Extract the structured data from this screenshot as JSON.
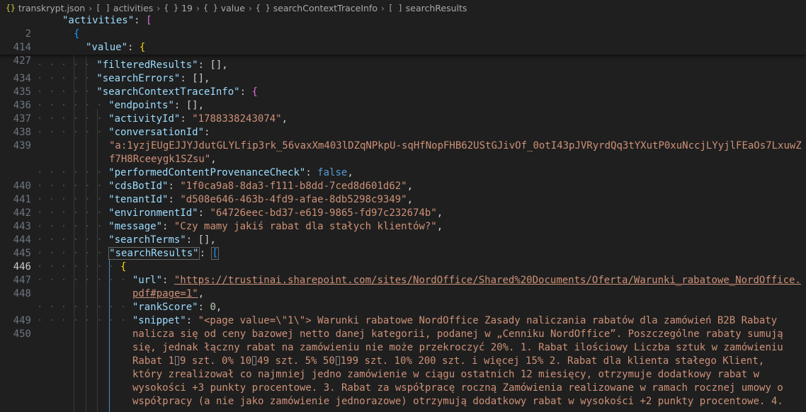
{
  "breadcrumb": {
    "file": "transkrypt.json",
    "segments": [
      "activities",
      "19",
      "value",
      "searchContextTraceInfo",
      "searchResults"
    ],
    "segment_icons": [
      "[ ]",
      "{ }",
      "{ }",
      "{ }",
      "[ ]"
    ]
  },
  "sticky": [
    {
      "ln": "2",
      "key": "\"activities\"",
      "punct": ": ",
      "open": "["
    },
    {
      "ln": "414",
      "open": "{"
    },
    {
      "ln": "427",
      "key": "\"value\"",
      "punct": ": ",
      "open": "{"
    }
  ],
  "lines": {
    "l434": {
      "ln": "434",
      "key": "\"filteredResults\"",
      "rest": ": [],"
    },
    "l435": {
      "ln": "435",
      "key": "\"searchErrors\"",
      "rest": ": [],"
    },
    "l436": {
      "ln": "436",
      "key": "\"searchContextTraceInfo\"",
      "rest": ": ",
      "open": "{"
    },
    "l437": {
      "ln": "437",
      "key": "\"endpoints\"",
      "rest": ": [],"
    },
    "l438": {
      "ln": "438",
      "key": "\"activityId\"",
      "rest": ": ",
      "val": "\"1788338243074\"",
      "end": ","
    },
    "l439": {
      "ln": "439",
      "key": "\"conversationId\"",
      "rest": ":",
      "val1": "\"a:1yzjEUgEJJYJdutGLYLfip3rk_56vaxXm403lDZqNPkpU-sqHfNopFHB62UStGJivOf_0otI43pJVRyrdQq3tYXutP0xuNccjLYyjlFEaOs7LxuwZ",
      "val2": "f7H8Rceeygk1SZsu\"",
      "end": ","
    },
    "l440": {
      "ln": "440",
      "key": "\"performedContentProvenanceCheck\"",
      "rest": ": ",
      "val": "false",
      "end": ","
    },
    "l441": {
      "ln": "441",
      "key": "\"cdsBotId\"",
      "rest": ": ",
      "val": "\"1f0ca9a8-8da3-f111-b8dd-7ced8d601d62\"",
      "end": ","
    },
    "l442": {
      "ln": "442",
      "key": "\"tenantId\"",
      "rest": ": ",
      "val": "\"d508e646-463b-4fd9-afae-8db5298c9349\"",
      "end": ","
    },
    "l443": {
      "ln": "443",
      "key": "\"environmentId\"",
      "rest": ": ",
      "val": "\"64726eec-bd37-e619-9865-fd97c232674b\"",
      "end": ","
    },
    "l444": {
      "ln": "444",
      "key": "\"message\"",
      "rest": ": ",
      "val": "\"Czy mamy jakiś rabat dla stałych klientów?\"",
      "end": ","
    },
    "l445": {
      "ln": "445",
      "key": "\"searchTerms\"",
      "rest": ": [],"
    },
    "l446": {
      "ln": "446",
      "key": "\"searchResults\"",
      "rest": ": ",
      "open": "["
    },
    "l447": {
      "ln": "447",
      "open": "{"
    },
    "l448": {
      "ln": "448",
      "key": "\"url\"",
      "rest": ": ",
      "val1": "\"https://trustinai.sharepoint.com/sites/NordOffice/Shared%20Documents/Oferta/Warunki_rabatowe_NordOffice.",
      "val2": "pdf#page=1\"",
      "end": ","
    },
    "l449": {
      "ln": "449",
      "key": "\"rankScore\"",
      "rest": ": ",
      "val": "0",
      "end": ","
    },
    "l450": {
      "ln": "450",
      "key": "\"snippet\"",
      "rest": ": ",
      "w1": "\"<page value=\\\"1\\\"> Warunki rabatowe NordOffice Zasady naliczania rabatów dla zamówień B2B Rabaty",
      "w2": "nalicza się od ceny bazowej netto danej kategorii, podanej w „Cenniku NordOffice”. Poszczególne rabaty sumują",
      "w3": "się, jednak łączny rabat na zamówieniu nie może przekroczyć 20%. 1. Rabat ilościowy Liczba sztuk w zamówieniu",
      "w4a": "Rabat 1",
      "w4b": "9 szt. 0% 10",
      "w4c": "49 szt. 5% 50",
      "w4d": "199 szt. 10% 200 szt. i więcej 15% 2. Rabat dla klienta stałego Klient,",
      "w5": "który zrealizował co najmniej jedno zamówienie w ciągu ostatnich 12 miesięcy, otrzymuje dodatkowy rabat w",
      "w6": "wysokości +3 punkty procentowe. 3. Rabat za współpracę roczną Zamówienia realizowane w ramach rocznej umowy o",
      "w7": "współpracy (a nie jako zamówienie jednorazowe) otrzymują dodatkowy rabat w wysokości +2 punkty procentowe. 4."
    }
  }
}
